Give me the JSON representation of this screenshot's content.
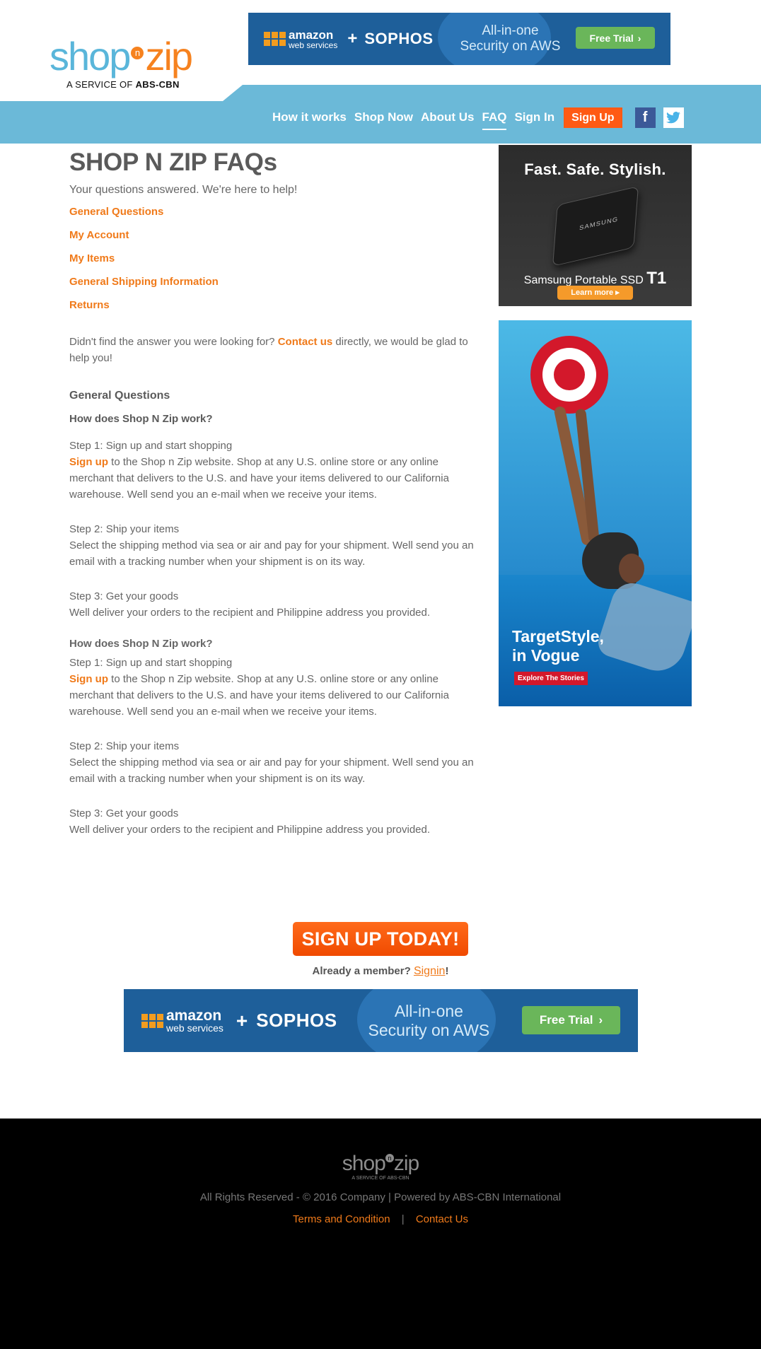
{
  "header": {
    "logo": {
      "word_shop": "shop",
      "word_n": "n",
      "word_zip": "zip",
      "tagline_prefix": "A SERVICE OF",
      "tagline_brand": "ABS-CBN"
    },
    "nav": [
      {
        "label": "How it works"
      },
      {
        "label": "Shop Now"
      },
      {
        "label": "About Us"
      },
      {
        "label": "FAQ",
        "active": true
      },
      {
        "label": "Sign In"
      }
    ],
    "signup_label": "Sign Up",
    "social": {
      "facebook_glyph": "f",
      "twitter_glyph": "t",
      "facebook_icon": "facebook-icon",
      "twitter_icon": "twitter-icon"
    }
  },
  "ads": {
    "aws": {
      "brand_line1": "amazon",
      "brand_line2": "web services",
      "plus": "+",
      "partner": "SOPHOS",
      "headline_line1": "All-in-one",
      "headline_line2": "Security on AWS",
      "cta": "Free Trial",
      "cta_icon": "chevron-right-icon"
    },
    "samsung": {
      "tagline": "Fast. Safe. Stylish.",
      "device_brand": "SAMSUNG",
      "product": "Samsung Portable SSD",
      "product_model": "T1",
      "cta": "Learn more ▸"
    },
    "target": {
      "title_line1": "TargetStyle,",
      "title_line2": "in Vogue",
      "cta": "Explore The Stories"
    }
  },
  "main": {
    "title": "SHOP N ZIP FAQs",
    "subtitle": "Your questions answered. We're here to help!",
    "toc": [
      "General Questions",
      "My Account",
      "My Items",
      "General Shipping Information",
      "Returns"
    ],
    "contact": {
      "prefix": "Didn't find the answer you were looking for?",
      "link": "Contact us",
      "suffix": "directly, we would be glad to help you!"
    },
    "section_heading": "General Questions",
    "question1": "How does Shop N Zip work?",
    "question2": "How does Shop N Zip work?",
    "steps": {
      "step1_title": "Step 1: Sign up and start shopping",
      "step1_link": "Sign up",
      "step1_text": "to the Shop n Zip website. Shop at any U.S. online store or any online merchant that delivers to the U.S. and have your items delivered to our California warehouse. Well send you an e-mail when we receive your items.",
      "step2_title": "Step 2: Ship your items",
      "step2_text": "Select the shipping method via sea or air and pay for your shipment. Well send you an email with a tracking number when your shipment is on its way.",
      "step3_title": "Step 3: Get your goods",
      "step3_text": "Well deliver your orders to the recipient and Philippine address you provided."
    }
  },
  "cta": {
    "button": "SIGN UP TODAY!",
    "member_prefix": "Already a member?",
    "member_link": "Signin",
    "member_suffix": "!"
  },
  "footer": {
    "logo_shop": "shop",
    "logo_n": "n",
    "logo_zip": "zip",
    "logo_tagline": "A SERVICE OF ABS-CBN",
    "copyright": "All Rights Reserved - © 2016 Company | Powered by ABS-CBN International",
    "links": [
      "Terms and Condition",
      "Contact Us"
    ],
    "separator": "|"
  },
  "colors": {
    "accent": "#f07a1a",
    "nav_bg": "#6bb9d8",
    "signup": "#ff5a14",
    "footer_bg": "#000000"
  }
}
